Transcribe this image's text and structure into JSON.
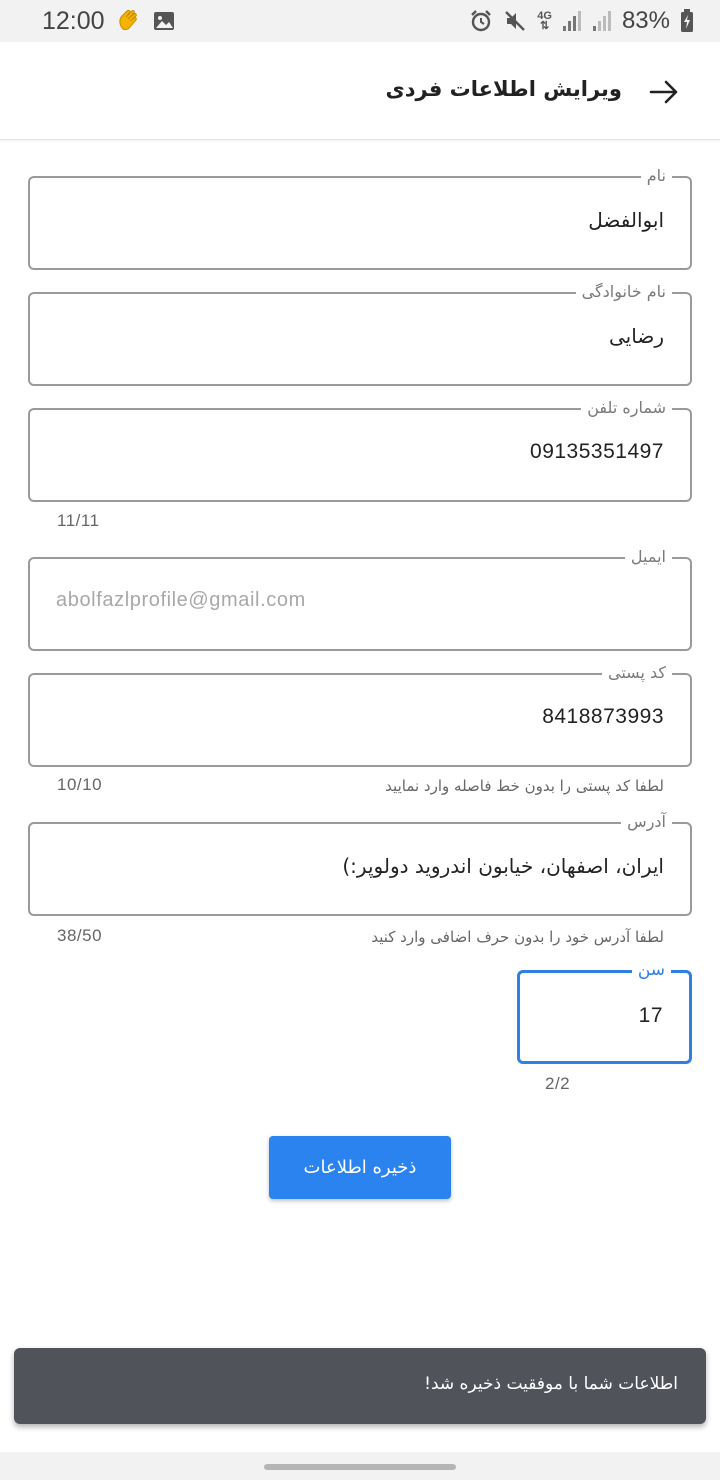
{
  "status_bar": {
    "time": "12:00",
    "battery_percent": "83%",
    "network": "4G",
    "icons": [
      "waving-hand-icon",
      "image-icon",
      "alarm-icon",
      "mute-icon",
      "signal-icon",
      "signal-icon",
      "battery-charging-icon"
    ]
  },
  "header": {
    "title": "ویرایش اطلاعات فردی",
    "back_icon": "arrow-right-icon"
  },
  "form": {
    "first_name": {
      "label": "نام",
      "value": "ابوالفضل"
    },
    "last_name": {
      "label": "نام خانوادگی",
      "value": "رضایی"
    },
    "phone": {
      "label": "شماره تلفن",
      "value": "09135351497",
      "counter": "11/11"
    },
    "email": {
      "label": "ایمیل",
      "value": "abolfazlprofile@gmail.com"
    },
    "postal_code": {
      "label": "کد پستی",
      "value": "8418873993",
      "counter": "10/10",
      "helper": "لطفا کد پستی را بدون خط فاصله وارد نمایید"
    },
    "address": {
      "label": "آدرس",
      "value": "ایران، اصفهان، خیابون اندروید دولوپر:)",
      "counter": "38/50",
      "helper": "لطفا آدرس خود را بدون حرف اضافی وارد کنید"
    },
    "age": {
      "label": "سن",
      "value": "17",
      "counter": "2/2"
    }
  },
  "save_button": {
    "label": "ذخیره اطلاعات"
  },
  "snackbar": {
    "message": "اطلاعات شما با موفقیت ذخیره شد!"
  },
  "colors": {
    "accent": "#2a83ef",
    "focus": "#2f7fe4",
    "snackbar": "#51535b",
    "field_border": "#9a9a9a"
  }
}
